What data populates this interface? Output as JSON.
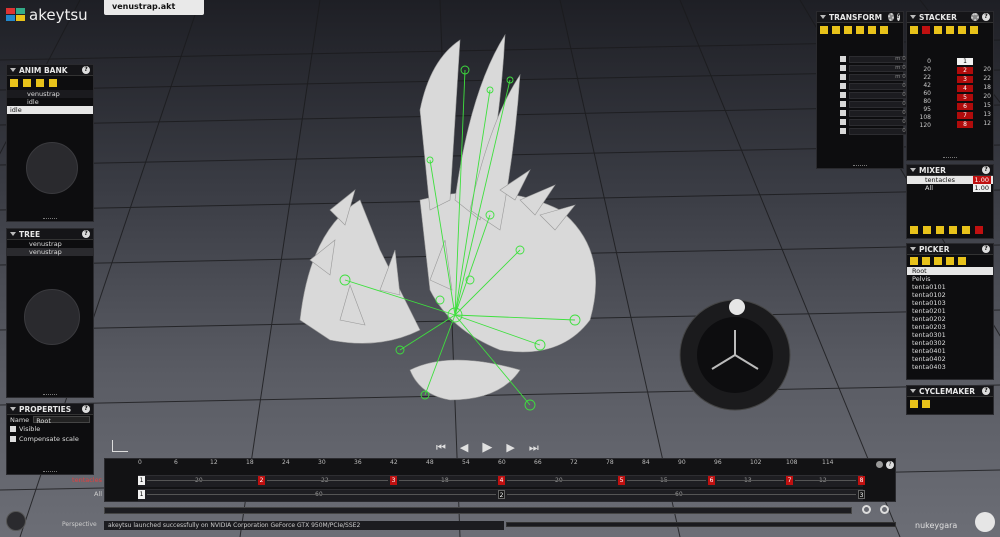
{
  "app": {
    "logo_text": "akeytsu",
    "document_tab": "venustrap.akt",
    "brand": "nukeygara",
    "accent_red": "#c01010",
    "accent_yellow": "#e8c21a"
  },
  "anim_bank": {
    "title": "ANIM BANK",
    "project": "venustrap",
    "sub": "idle",
    "selected": "idle"
  },
  "tree": {
    "title": "TREE",
    "items": [
      "venustrap",
      "venustrap"
    ]
  },
  "properties": {
    "title": "PROPERTIES",
    "name_label": "Name",
    "name_value": "Root",
    "visible_label": "Visible",
    "compensate_label": "Compensate scale"
  },
  "transform": {
    "title": "TRANSFORM",
    "values": [
      "m 0.000",
      "m 0.000",
      "m 0.000",
      "0.000",
      "0.000",
      "0.000",
      "0.000",
      "0.000",
      "0.000"
    ]
  },
  "stacker": {
    "title": "STACKER",
    "left": [
      "0",
      "20",
      "22",
      "42",
      "60",
      "80",
      "95",
      "108",
      "120"
    ],
    "keys": [
      "1",
      "2",
      "3",
      "4",
      "5",
      "6",
      "7",
      "8"
    ],
    "right": [
      "20",
      "22",
      "18",
      "20",
      "15",
      "13",
      "12"
    ]
  },
  "mixer": {
    "title": "MIXER",
    "layers": [
      {
        "name": "tentacles",
        "value": "1.00"
      },
      {
        "name": "All",
        "value": "1.00"
      }
    ]
  },
  "picker": {
    "title": "PICKER",
    "items": [
      "Root",
      "Pelvis",
      "tenta0101",
      "tenta0102",
      "tenta0103",
      "tenta0201",
      "tenta0202",
      "tenta0203",
      "tenta0301",
      "tenta0302",
      "tenta0401",
      "tenta0402",
      "tenta0403"
    ]
  },
  "cyclemaker": {
    "title": "CYCLEMAKER"
  },
  "timeline": {
    "ticks": [
      "0",
      "6",
      "12",
      "18",
      "24",
      "30",
      "36",
      "42",
      "48",
      "54",
      "60",
      "66",
      "72",
      "78",
      "84",
      "90",
      "96",
      "102",
      "108",
      "114"
    ],
    "tracks": [
      {
        "label": "tentacles",
        "keys": [
          "1",
          "2",
          "3",
          "4",
          "5",
          "6",
          "7",
          "8"
        ],
        "segments": [
          "20",
          "22",
          "18",
          "20",
          "15",
          "13",
          "12"
        ]
      },
      {
        "label": "All",
        "keys": [
          "1",
          "2",
          "3"
        ],
        "segments": [
          "60",
          "60"
        ]
      }
    ]
  },
  "status": {
    "camera": "Perspective",
    "message": "akeytsu launched successfully on NVIDIA Corporation GeForce GTX 950M/PCIe/SSE2"
  }
}
